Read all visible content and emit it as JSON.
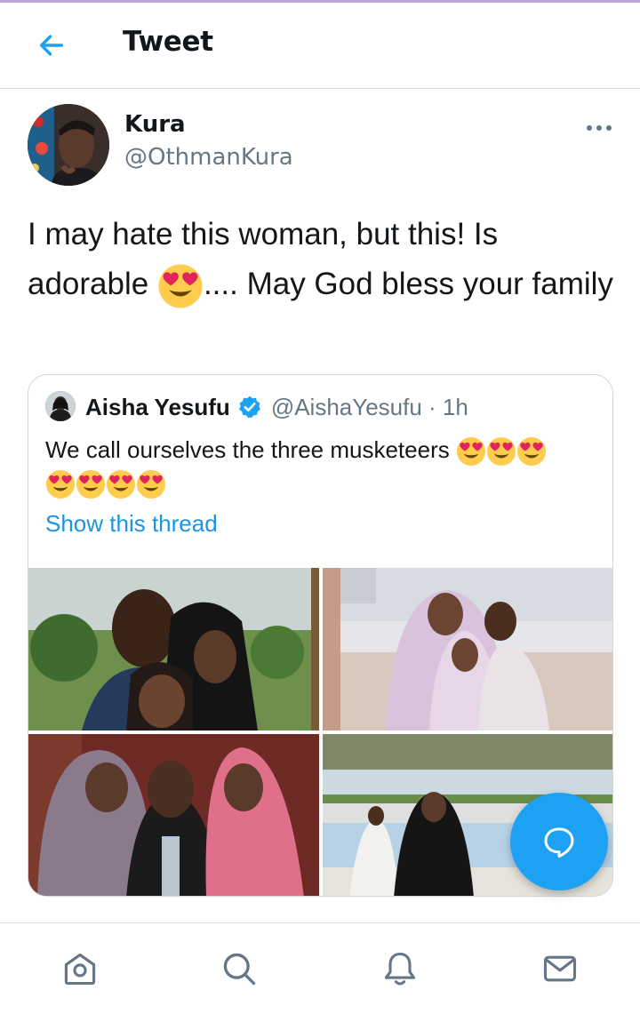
{
  "header": {
    "title": "Tweet",
    "back_icon": "arrow-left-icon"
  },
  "tweet": {
    "author_name": "Kura",
    "author_handle": "@OthmanKura",
    "text_part1": "I may hate this woman, but this! Is adorable ",
    "text_emoji": "heart-eyes-emoji",
    "text_part2": ".... May God bless your family",
    "more_icon": "more-horizontal-icon"
  },
  "quote": {
    "author_name": "Aisha Yesufu",
    "verified": true,
    "handle_time": "@AishaYesufu · 1h",
    "text": "We call ourselves the three musketeers",
    "emoji_count": 7,
    "show_thread": "Show this thread"
  },
  "photos": [
    {
      "name": "photo-family-outdoor"
    },
    {
      "name": "photo-beach"
    },
    {
      "name": "photo-studio-portrait"
    },
    {
      "name": "photo-poolside"
    }
  ],
  "fab": {
    "icon": "compose-reply-icon"
  },
  "bottom_nav": [
    {
      "name": "home",
      "icon": "home-icon"
    },
    {
      "name": "search",
      "icon": "search-icon"
    },
    {
      "name": "notifications",
      "icon": "bell-icon"
    },
    {
      "name": "messages",
      "icon": "mail-icon"
    }
  ],
  "colors": {
    "accent": "#1da1f2",
    "link": "#1b95e0",
    "secondary_text": "#657786",
    "border": "#ccd6dd"
  }
}
